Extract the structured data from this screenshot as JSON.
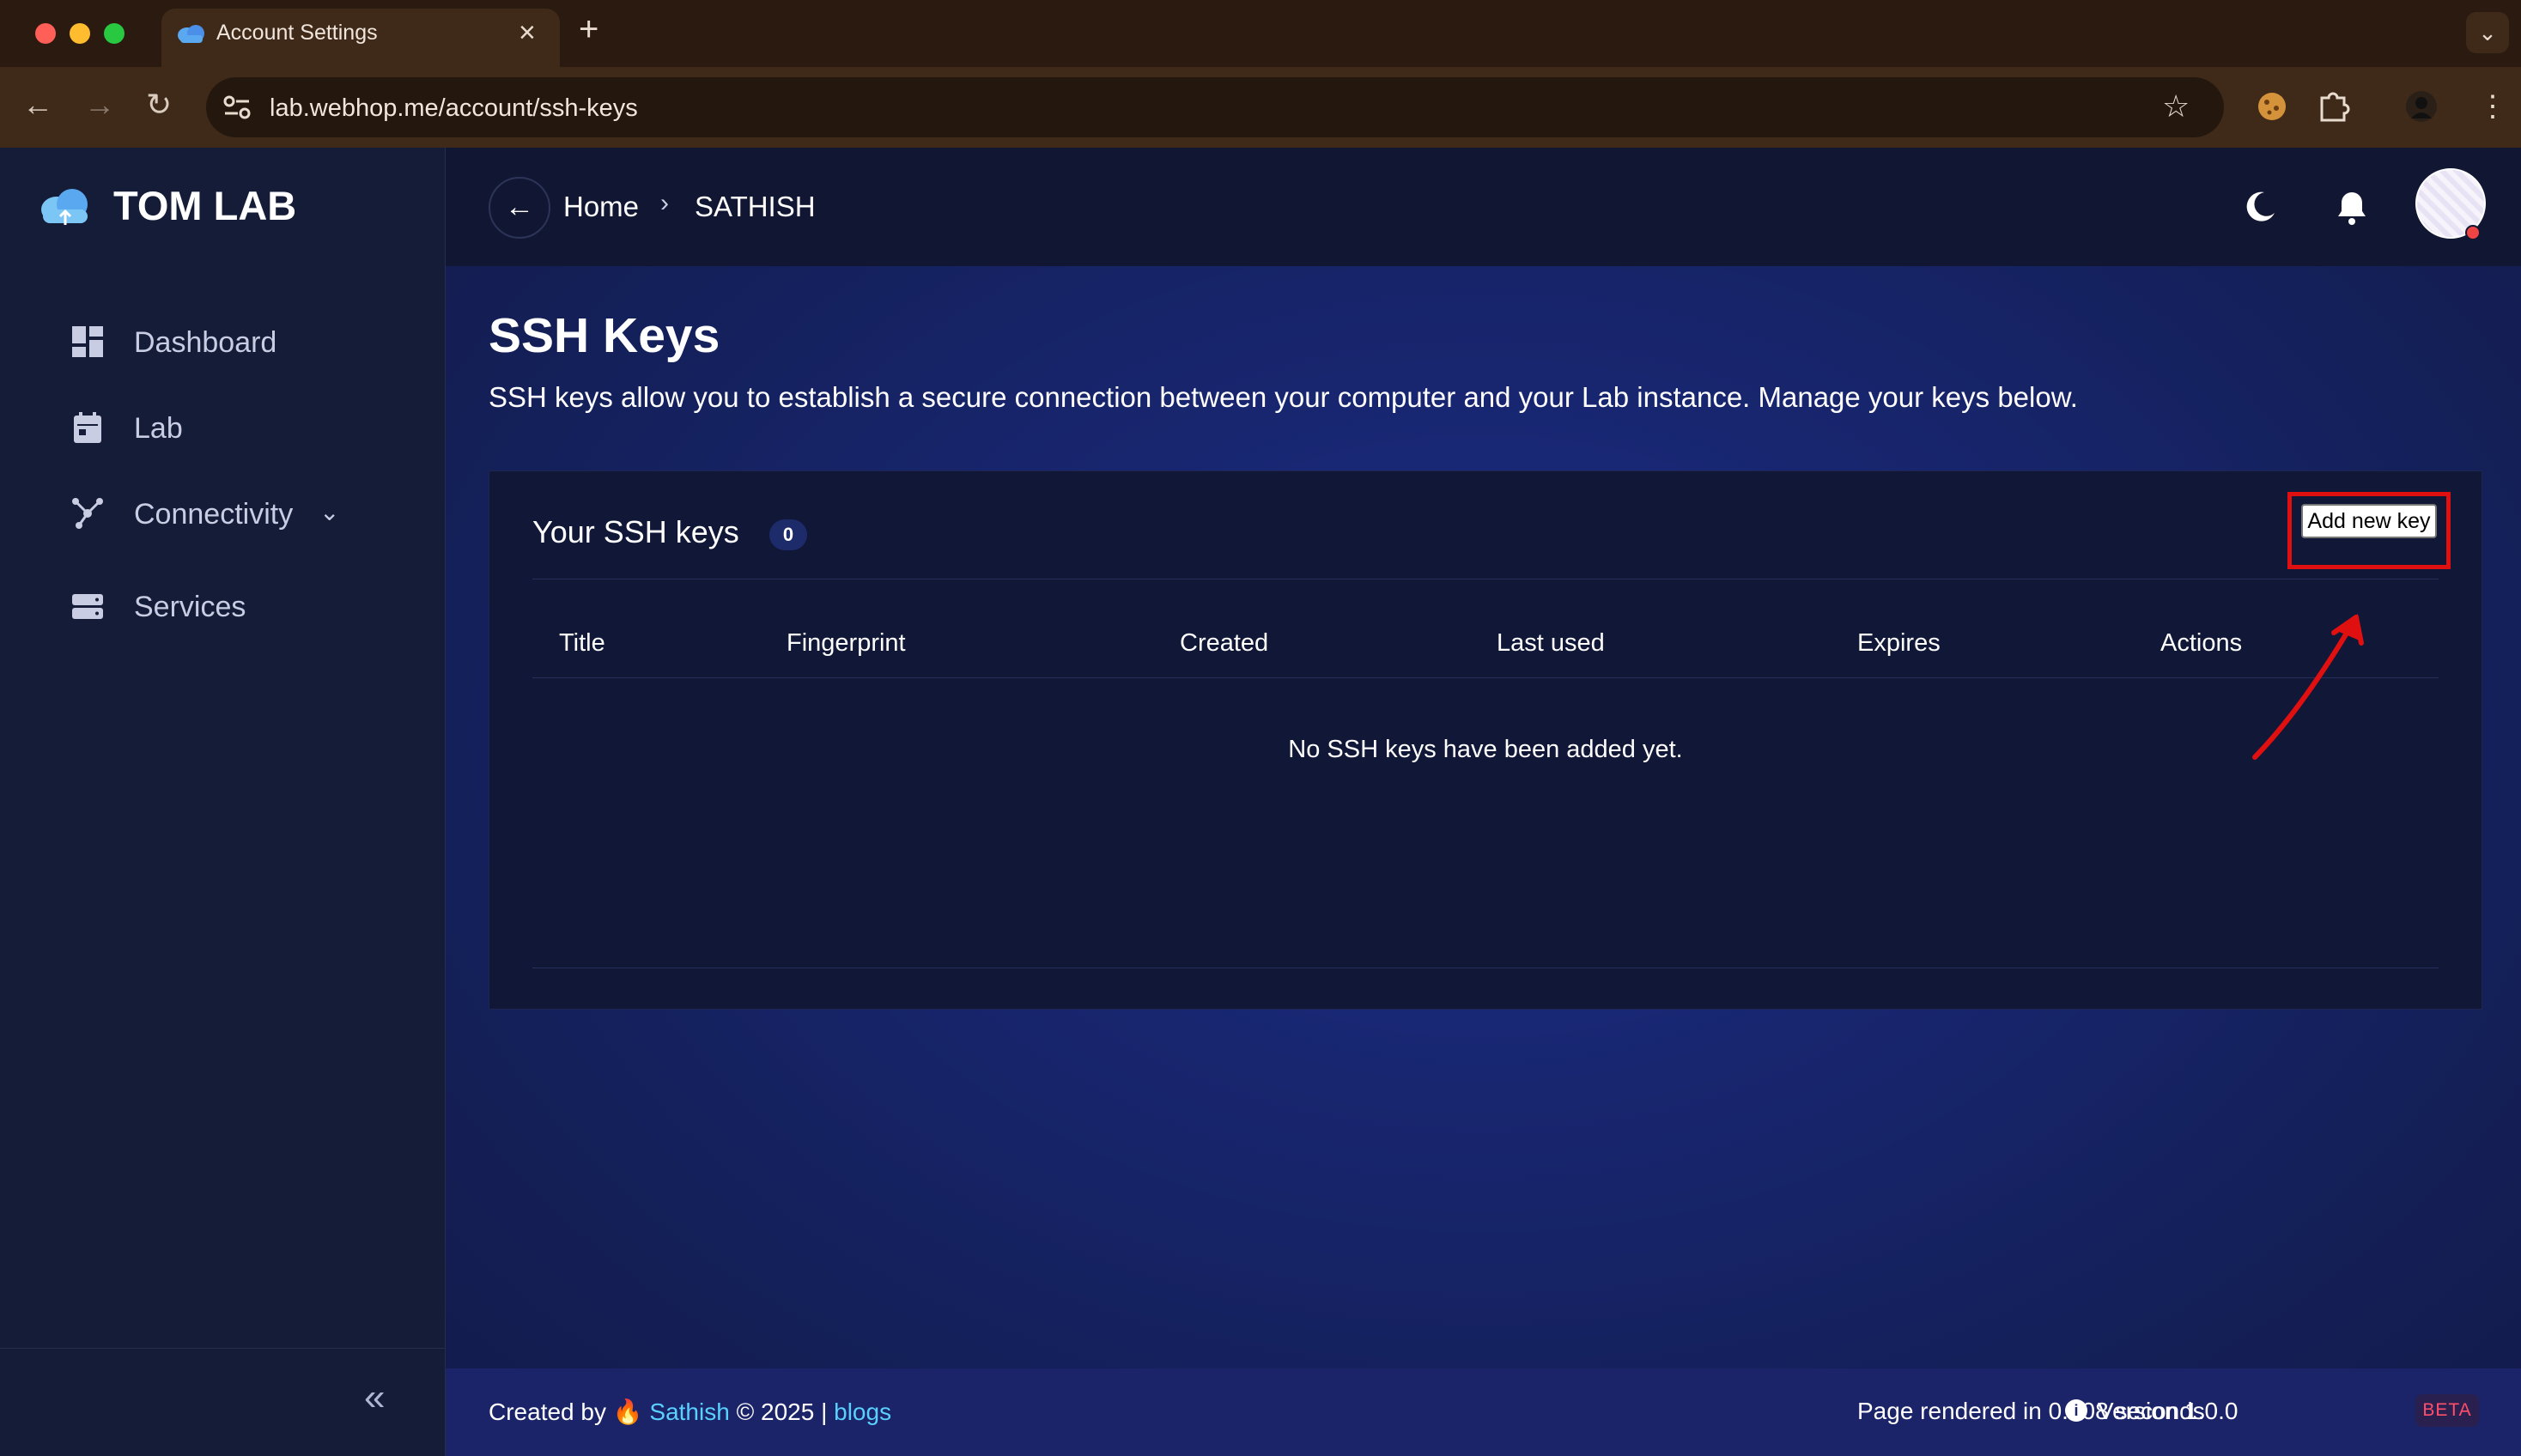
{
  "browser": {
    "tab_title": "Account Settings",
    "tab_close": "×",
    "new_tab": "+",
    "tab_menu": "⌄",
    "url": "lab.webhop.me/account/ssh-keys",
    "back": "←",
    "forward": "→",
    "reload": "↻",
    "star": "☆",
    "menu": "⋮"
  },
  "sidebar": {
    "brand": "TOM LAB",
    "items": [
      {
        "label": "Dashboard",
        "icon": "dashboard-icon"
      },
      {
        "label": "Lab",
        "icon": "calendar-icon"
      },
      {
        "label": "Connectivity",
        "icon": "network-icon",
        "has_dropdown": true
      },
      {
        "label": "Services",
        "icon": "server-icon"
      }
    ],
    "connectivity_chevron": "⌄",
    "collapse": "«"
  },
  "topbar": {
    "back": "←",
    "breadcrumb_home": "Home",
    "breadcrumb_sep": "›",
    "breadcrumb_user": "SATHISH"
  },
  "page": {
    "title": "SSH Keys",
    "description": "SSH keys allow you to establish a secure connection between your computer and your Lab instance. Manage your keys below."
  },
  "card": {
    "title": "Your SSH keys",
    "count": "0",
    "add_button": "Add new key",
    "columns": [
      "Title",
      "Fingerprint",
      "Created",
      "Last used",
      "Expires",
      "Actions"
    ],
    "empty_message": "No SSH keys have been added yet."
  },
  "footer": {
    "created_by": "Created by",
    "flame": "🔥",
    "author": "Sathish",
    "copyright": "© 2025 |",
    "blogs": "blogs",
    "rendered": "Page rendered in 0.008 seconds",
    "version_icon": "i",
    "version": "Version 1.0.0",
    "beta": "BETA"
  },
  "colors": {
    "sidebar_bg": "#151c38",
    "main_bg": "#182670",
    "accent_link": "#5ad0ff",
    "highlight": "#e01010",
    "beta": "#ff4f6a"
  }
}
